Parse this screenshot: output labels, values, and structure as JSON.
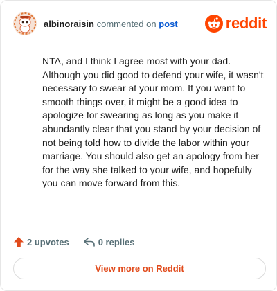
{
  "comment": {
    "author": "albinoraisin",
    "action": "commented on",
    "target": "post",
    "body": "NTA, and I think I agree most with your dad. Although you did good to defend your wife, it wasn't necessary to swear at your mom. If you want to smooth things over, it might be a good idea to apologize for swearing as long as you make it abundantly clear that you stand by your decision of not being told how to divide the labor within your marriage. You should also get an apology from her for the way she talked to your wife, and hopefully you can move forward from this."
  },
  "brand": {
    "name": "reddit",
    "color": "#ff4500"
  },
  "actions": {
    "upvotes": "2 upvotes",
    "replies": "0 replies"
  },
  "footer": {
    "more_label": "View more on Reddit"
  },
  "icons": {
    "avatar": "snoo-avatar-icon",
    "logo": "reddit-logo-icon",
    "upvote": "upvote-arrow-icon",
    "reply": "reply-arrow-icon"
  }
}
